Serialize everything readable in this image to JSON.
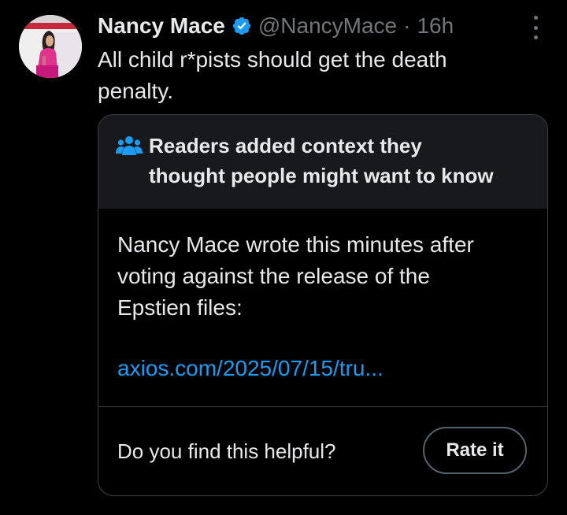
{
  "tweet": {
    "author": {
      "display_name": "Nancy Mace",
      "verified": true,
      "handle": "@NancyMace",
      "separator": "·",
      "time": "16h",
      "verified_color": "#1d9bf0"
    },
    "text_line1": "All child r*pists should get the death",
    "text_line2": "penalty."
  },
  "community_note": {
    "title_line1": "Readers added context they",
    "title_line2": "thought people might want to know",
    "body_line1": "Nancy Mace wrote this minutes after",
    "body_line2": "voting against the release of the",
    "body_line3": "Epstien files:",
    "link": "axios.com/2025/07/15/tru...",
    "helpful_prompt": "Do you find this helpful?",
    "rate_button": "Rate it",
    "accent_color": "#1d9bf0"
  },
  "icons": {
    "more": "more-options-icon",
    "verified": "verified-badge-icon",
    "people": "people-icon"
  }
}
